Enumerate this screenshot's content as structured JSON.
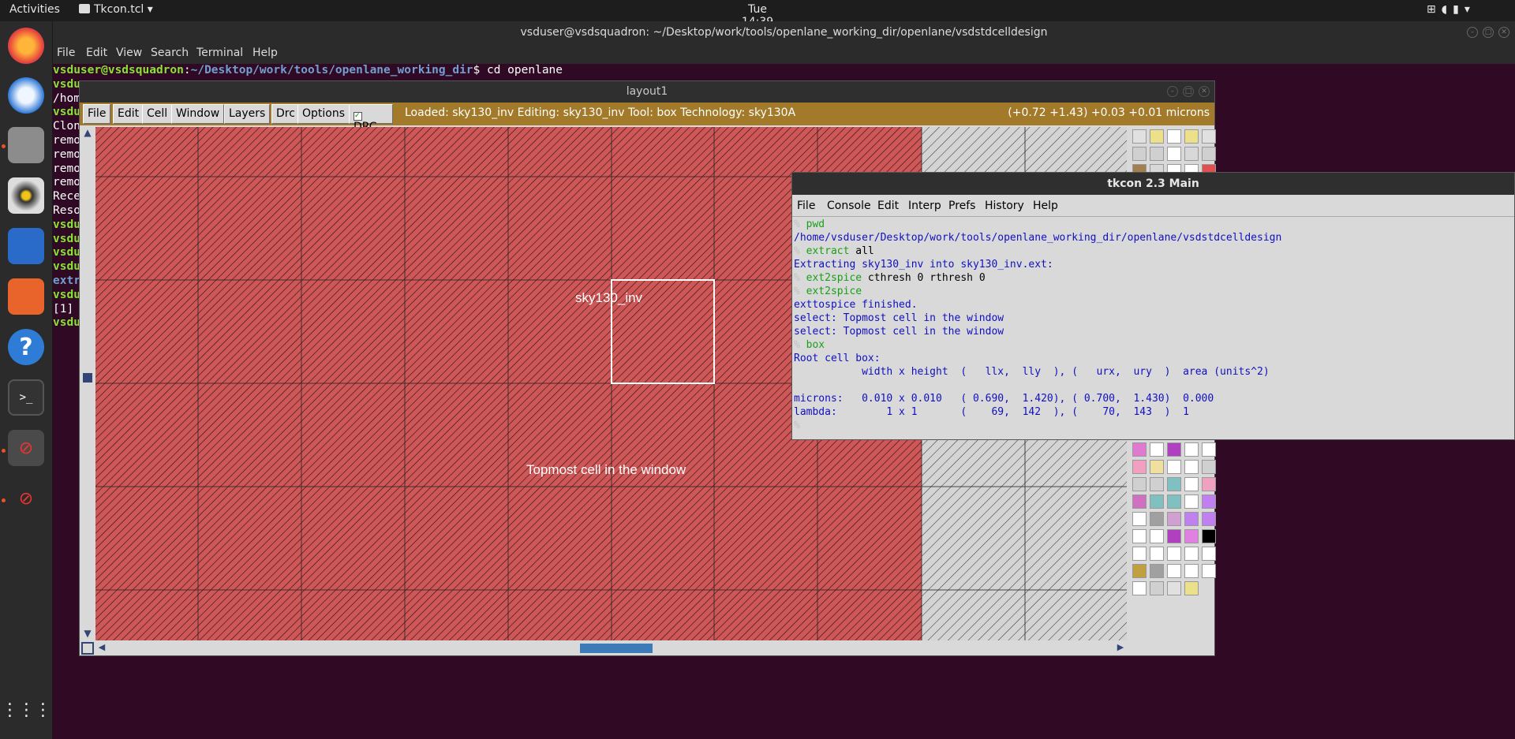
{
  "topbar": {
    "activities": "Activities",
    "app": "Tkcon.tcl",
    "clock": "Tue 14:39"
  },
  "terminal": {
    "title": "vsduser@vsdsquadron: ~/Desktop/work/tools/openlane_working_dir/openlane/vsdstdcelldesign",
    "menu": [
      "File",
      "Edit",
      "View",
      "Search",
      "Terminal",
      "Help"
    ],
    "prompt_user": "vsduser@vsdsquadron",
    "prompt_path": "~/Desktop/work/tools/openlane_working_dir",
    "first_cmd": "$ cd openlane",
    "lines": [
      "vsdu",
      "/hom",
      "vsdu",
      "Clon",
      "remo",
      "remo",
      "remo",
      "remo",
      "Rece",
      "Reso",
      "vsdu",
      "vsdu",
      "vsdu",
      "vsdu",
      "extr",
      "vsdu",
      "[1]",
      "vsdu"
    ]
  },
  "layout": {
    "title": "layout1",
    "menu": [
      "File",
      "Edit",
      "Cell",
      "Window",
      "Layers",
      "Drc",
      "Options"
    ],
    "drc": "DRC",
    "status": "Loaded: sky130_inv Editing: sky130_inv Tool: box  Technology: sky130A",
    "coords": "(+0.72 +1.43) +0.03 +0.01 microns",
    "cell_label": "sky130_inv",
    "window_label": "Topmost cell in the window"
  },
  "tkcon": {
    "title": "tkcon 2.3 Main",
    "menu": [
      "File",
      "Console",
      "Edit",
      "Interp",
      "Prefs",
      "History",
      "Help"
    ],
    "lines": [
      {
        "p": "% ",
        "c": "pwd",
        "t": "cmd"
      },
      {
        "p": "",
        "c": "/home/vsduser/Desktop/work/tools/openlane_working_dir/openlane/vsdstdcelldesign",
        "t": "out"
      },
      {
        "p": "% ",
        "c": "extract",
        "a": " all",
        "t": "cmd"
      },
      {
        "p": "",
        "c": "Extracting sky130_inv into sky130_inv.ext:",
        "t": "out"
      },
      {
        "p": "% ",
        "c": "ext2spice",
        "a": " cthresh 0 rthresh 0",
        "t": "cmd"
      },
      {
        "p": "% ",
        "c": "ext2spice",
        "t": "cmd"
      },
      {
        "p": "",
        "c": "exttospice finished.",
        "t": "out"
      },
      {
        "p": "",
        "c": "select: Topmost cell in the window",
        "t": "out"
      },
      {
        "p": "",
        "c": "select: Topmost cell in the window",
        "t": "out"
      },
      {
        "p": "% ",
        "c": "box",
        "t": "cmd"
      },
      {
        "p": "",
        "c": "Root cell box:",
        "t": "out"
      },
      {
        "p": "",
        "c": "           width x height  (   llx,  lly  ), (   urx,  ury  )  area (units^2)",
        "t": "out"
      },
      {
        "p": "",
        "c": "",
        "t": "out"
      },
      {
        "p": "",
        "c": "microns:   0.010 x 0.010   ( 0.690,  1.420), ( 0.700,  1.430)  0.000",
        "t": "out"
      },
      {
        "p": "",
        "c": "lambda:        1 x 1       (    69,  142  ), (    70,  143  )  1",
        "t": "out"
      },
      {
        "p": "%",
        "c": "",
        "t": "cmd"
      }
    ]
  }
}
